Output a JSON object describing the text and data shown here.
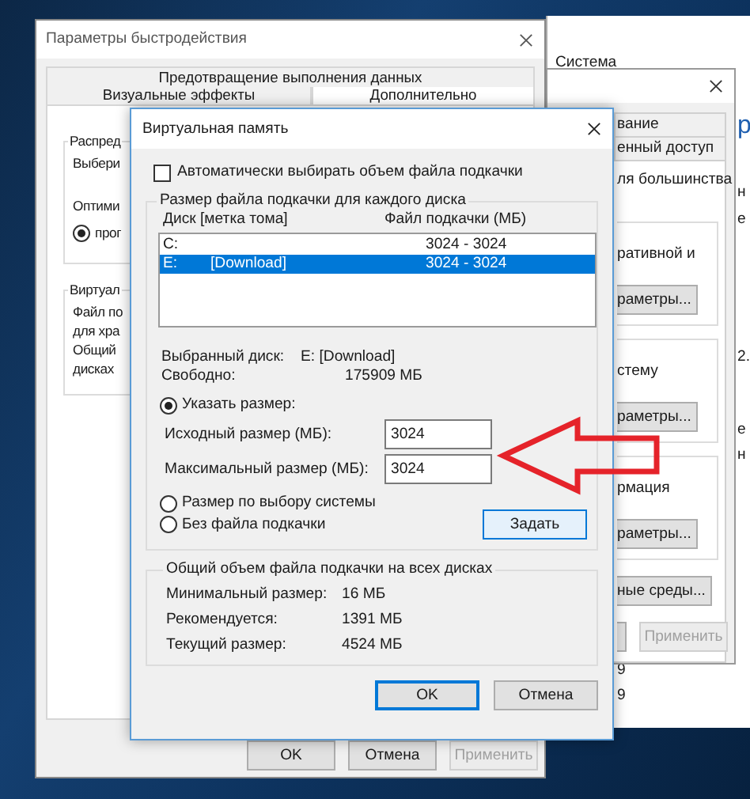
{
  "system_window": {
    "heading": "Система",
    "edge_texts": [
      "р",
      "н",
      "е",
      "2.",
      "е",
      "н"
    ],
    "bottom_texts": [
      "9",
      "9"
    ]
  },
  "system_properties": {
    "tabs": [
      "вание",
      "енный доступ"
    ],
    "intro": "ля большинства",
    "sections": [
      {
        "text": "ративной и",
        "button": "раметры..."
      },
      {
        "text": "стему",
        "button": "раметры..."
      },
      {
        "text": "рмация",
        "button": "раметры..."
      }
    ],
    "env_button": "ные среды...",
    "apply_button": {
      "label": "Применить",
      "disabled": true
    }
  },
  "performance_options": {
    "title": "Параметры быстродействия",
    "tabs": [
      {
        "label": "Предотвращение выполнения данных",
        "selected": false
      },
      {
        "label": "Визуальные эффекты",
        "selected": false
      },
      {
        "label": "Дополнительно",
        "selected": true
      }
    ],
    "groups": [
      {
        "label": "Распред",
        "lines": [
          "Выбери",
          "Оптими"
        ],
        "radio": {
          "label": "прог",
          "selected": true
        }
      },
      {
        "label": "Виртуал",
        "lines": [
          "Файл по",
          "для хра",
          "Общий",
          "дисках"
        ]
      }
    ],
    "buttons": [
      {
        "label": "OK",
        "disabled": false
      },
      {
        "label": "Отмена",
        "disabled": false
      },
      {
        "label": "Применить",
        "disabled": true
      }
    ]
  },
  "virtual_memory": {
    "title": "Виртуальная память",
    "auto_manage": {
      "label": "Автоматически выбирать объем файла подкачки",
      "checked": false
    },
    "drives_group": {
      "label": "Размер файла подкачки для каждого диска",
      "columns": [
        "Диск [метка тома]",
        "Файл подкачки (МБ)"
      ],
      "rows": [
        {
          "drive": "C:",
          "paging_file": "3024 - 3024",
          "selected": false
        },
        {
          "drive": "E:",
          "volume_label": "[Download]",
          "paging_file": "3024 - 3024",
          "selected": true
        }
      ],
      "selected_drive": {
        "label": "Выбранный диск:",
        "value": "E:  [Download]"
      },
      "free_space": {
        "label": "Свободно:",
        "value": "175909 МБ"
      },
      "options": [
        {
          "label": "Указать размер:",
          "selected": true
        },
        {
          "label": "Размер по выбору системы",
          "selected": false
        },
        {
          "label": "Без файла подкачки",
          "selected": false
        }
      ],
      "initial_size": {
        "label": "Исходный размер (МБ):",
        "value": "3024"
      },
      "maximum_size": {
        "label": "Максимальный размер (МБ):",
        "value": "3024"
      },
      "set_button": "Задать"
    },
    "totals_group": {
      "label": "Общий объем файла подкачки на всех дисках",
      "rows": [
        {
          "label": "Минимальный размер:",
          "value": "16 МБ"
        },
        {
          "label": "Рекомендуется:",
          "value": "1391 МБ"
        },
        {
          "label": "Текущий размер:",
          "value": "4524 МБ"
        }
      ]
    },
    "buttons": [
      {
        "label": "OK",
        "default": true
      },
      {
        "label": "Отмена",
        "default": false
      }
    ]
  }
}
